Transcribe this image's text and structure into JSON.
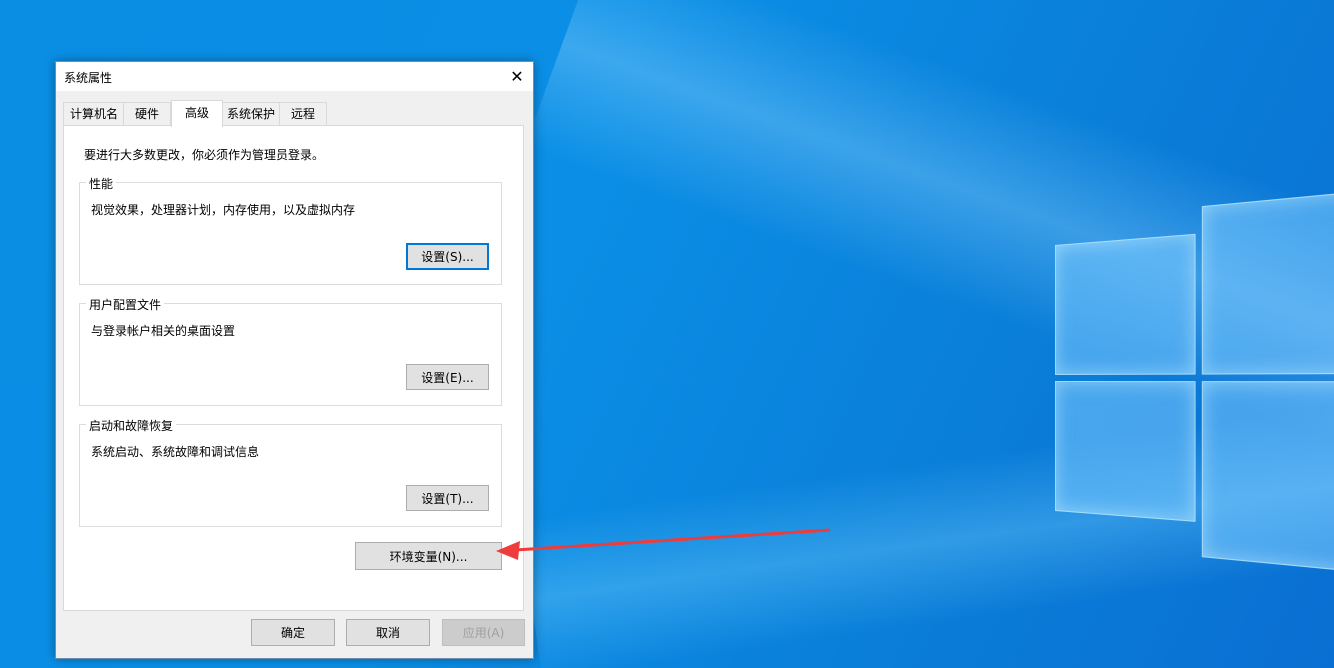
{
  "window": {
    "title": "系统属性",
    "close_glyph": "✕"
  },
  "tabs": [
    {
      "label": "计算机名"
    },
    {
      "label": "硬件"
    },
    {
      "label": "高级",
      "active": true
    },
    {
      "label": "系统保护"
    },
    {
      "label": "远程"
    }
  ],
  "notice": "要进行大多数更改，你必须作为管理员登录。",
  "groups": {
    "performance": {
      "title": "性能",
      "description": "视觉效果，处理器计划，内存使用，以及虚拟内存",
      "button": "设置(S)..."
    },
    "user_profiles": {
      "title": "用户配置文件",
      "description": "与登录帐户相关的桌面设置",
      "button": "设置(E)..."
    },
    "startup_recovery": {
      "title": "启动和故障恢复",
      "description": "系统启动、系统故障和调试信息",
      "button": "设置(T)..."
    }
  },
  "env_button": "环境变量(N)...",
  "footer": {
    "ok": "确定",
    "cancel": "取消",
    "apply": "应用(A)"
  },
  "colors": {
    "annotation_arrow": "#ee3b3b",
    "focus_border": "#0078d7",
    "desktop_blue": "#0a8ee4"
  },
  "icons": {
    "close": "close-icon",
    "annotation": "red-arrow-annotation"
  }
}
